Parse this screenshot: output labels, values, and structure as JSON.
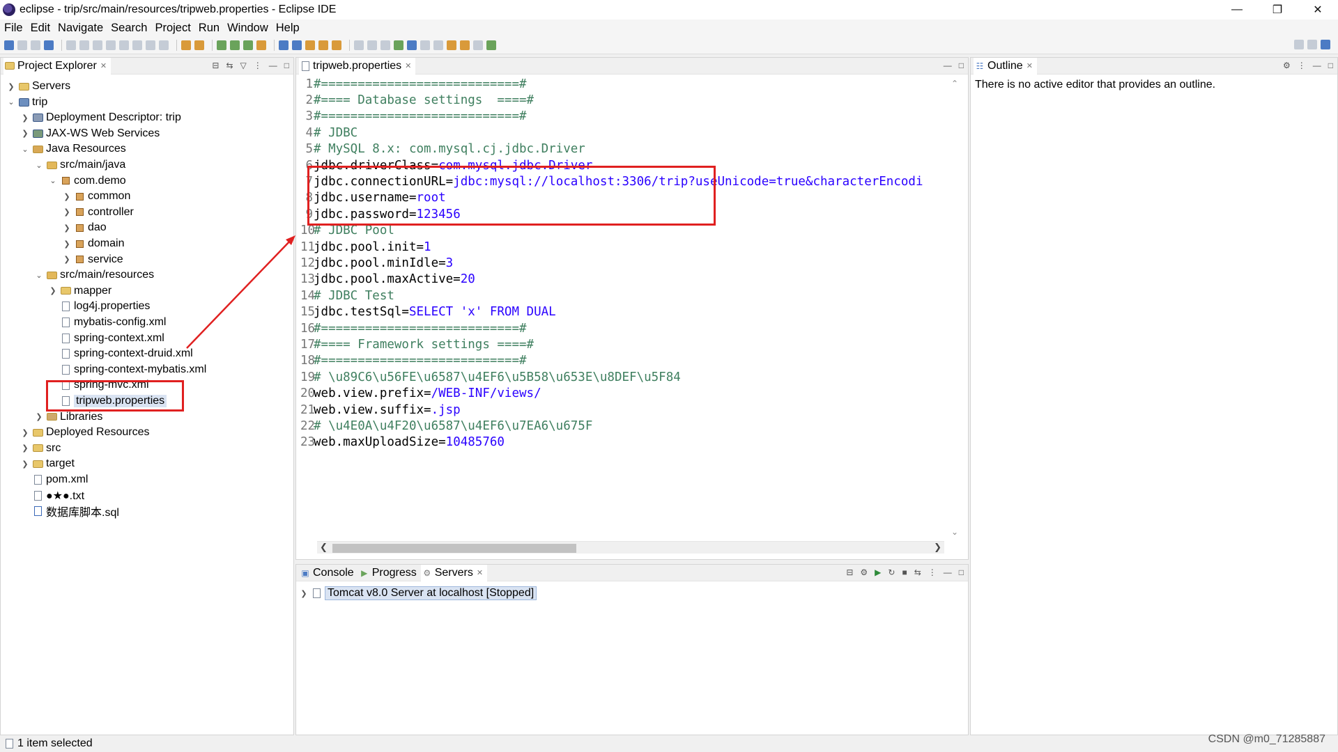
{
  "window": {
    "title": "eclipse - trip/src/main/resources/tripweb.properties - Eclipse IDE"
  },
  "menu": [
    "File",
    "Edit",
    "Navigate",
    "Search",
    "Project",
    "Run",
    "Window",
    "Help"
  ],
  "explorer": {
    "tab": "Project Explorer",
    "items": [
      {
        "label": "Servers",
        "depth": 0,
        "twisty": "collapsed",
        "icon": "folder-icon"
      },
      {
        "label": "trip",
        "depth": 0,
        "twisty": "expanded",
        "icon": "project-icon"
      },
      {
        "label": "Deployment Descriptor: trip",
        "depth": 1,
        "twisty": "collapsed",
        "icon": "descriptor-icon"
      },
      {
        "label": "JAX-WS Web Services",
        "depth": 1,
        "twisty": "collapsed",
        "icon": "webservice-icon"
      },
      {
        "label": "Java Resources",
        "depth": 1,
        "twisty": "expanded",
        "icon": "java-resources-icon"
      },
      {
        "label": "src/main/java",
        "depth": 2,
        "twisty": "expanded",
        "icon": "source-folder-icon"
      },
      {
        "label": "com.demo",
        "depth": 3,
        "twisty": "expanded",
        "icon": "package-icon"
      },
      {
        "label": "common",
        "depth": 4,
        "twisty": "collapsed",
        "icon": "package-icon"
      },
      {
        "label": "controller",
        "depth": 4,
        "twisty": "collapsed",
        "icon": "package-icon"
      },
      {
        "label": "dao",
        "depth": 4,
        "twisty": "collapsed",
        "icon": "package-icon"
      },
      {
        "label": "domain",
        "depth": 4,
        "twisty": "collapsed",
        "icon": "package-icon"
      },
      {
        "label": "service",
        "depth": 4,
        "twisty": "collapsed",
        "icon": "package-icon"
      },
      {
        "label": "src/main/resources",
        "depth": 2,
        "twisty": "expanded",
        "icon": "source-folder-icon"
      },
      {
        "label": "mapper",
        "depth": 3,
        "twisty": "collapsed",
        "icon": "folder-icon"
      },
      {
        "label": "log4j.properties",
        "depth": 3,
        "twisty": "none",
        "icon": "file-icon"
      },
      {
        "label": "mybatis-config.xml",
        "depth": 3,
        "twisty": "none",
        "icon": "xml-file-icon"
      },
      {
        "label": "spring-context.xml",
        "depth": 3,
        "twisty": "none",
        "icon": "xml-file-icon"
      },
      {
        "label": "spring-context-druid.xml",
        "depth": 3,
        "twisty": "none",
        "icon": "xml-file-icon"
      },
      {
        "label": "spring-context-mybatis.xml",
        "depth": 3,
        "twisty": "none",
        "icon": "xml-file-icon"
      },
      {
        "label": "spring-mvc.xml",
        "depth": 3,
        "twisty": "none",
        "icon": "xml-file-icon"
      },
      {
        "label": "tripweb.properties",
        "depth": 3,
        "twisty": "none",
        "icon": "file-icon",
        "selected": true
      },
      {
        "label": "Libraries",
        "depth": 2,
        "twisty": "collapsed",
        "icon": "library-icon"
      },
      {
        "label": "Deployed Resources",
        "depth": 1,
        "twisty": "collapsed",
        "icon": "folder-icon"
      },
      {
        "label": "src",
        "depth": 1,
        "twisty": "collapsed",
        "icon": "folder-icon"
      },
      {
        "label": "target",
        "depth": 1,
        "twisty": "collapsed",
        "icon": "folder-icon"
      },
      {
        "label": "pom.xml",
        "depth": 1,
        "twisty": "none",
        "icon": "xml-file-icon"
      },
      {
        "label": "●★●.txt",
        "depth": 1,
        "twisty": "none",
        "icon": "file-icon"
      },
      {
        "label": "数据库脚本.sql",
        "depth": 1,
        "twisty": "none",
        "icon": "sql-file-icon"
      }
    ]
  },
  "editor": {
    "tab": "tripweb.properties",
    "lines": [
      {
        "n": "1",
        "parts": [
          {
            "t": "#===========================#",
            "c": "c-comment"
          }
        ]
      },
      {
        "n": "2",
        "parts": [
          {
            "t": "#==== Database settings  ====#",
            "c": "c-comment"
          }
        ]
      },
      {
        "n": "3",
        "parts": [
          {
            "t": "#===========================#",
            "c": "c-comment"
          }
        ]
      },
      {
        "n": "4",
        "parts": [
          {
            "t": "# JDBC",
            "c": "c-comment"
          }
        ]
      },
      {
        "n": "5",
        "parts": [
          {
            "t": "# MySQL 8.x: com.mysql.cj.jdbc.Driver",
            "c": "c-comment"
          }
        ]
      },
      {
        "n": "6",
        "parts": [
          {
            "t": "jdbc.driverClass=",
            "c": "c-key"
          },
          {
            "t": "com.mysql.jdbc.Driver",
            "c": "c-val"
          }
        ]
      },
      {
        "n": "7",
        "parts": [
          {
            "t": "jdbc.connectionURL=",
            "c": "c-key"
          },
          {
            "t": "jdbc:mysql://localhost:3306/trip?useUnicode=true&characterEncodi",
            "c": "c-val"
          }
        ]
      },
      {
        "n": "8",
        "parts": [
          {
            "t": "jdbc.username=",
            "c": "c-key"
          },
          {
            "t": "root",
            "c": "c-val"
          }
        ]
      },
      {
        "n": "9",
        "parts": [
          {
            "t": "jdbc.password=",
            "c": "c-key"
          },
          {
            "t": "123456",
            "c": "c-val"
          }
        ]
      },
      {
        "n": "10",
        "parts": [
          {
            "t": "# JDBC Pool",
            "c": "c-comment"
          }
        ]
      },
      {
        "n": "11",
        "parts": [
          {
            "t": "jdbc.pool.init=",
            "c": "c-key"
          },
          {
            "t": "1",
            "c": "c-val"
          }
        ]
      },
      {
        "n": "12",
        "parts": [
          {
            "t": "jdbc.pool.minIdle=",
            "c": "c-key"
          },
          {
            "t": "3",
            "c": "c-val"
          }
        ]
      },
      {
        "n": "13",
        "parts": [
          {
            "t": "jdbc.pool.maxActive=",
            "c": "c-key"
          },
          {
            "t": "20",
            "c": "c-val"
          }
        ]
      },
      {
        "n": "14",
        "parts": [
          {
            "t": "# JDBC Test",
            "c": "c-comment"
          }
        ]
      },
      {
        "n": "15",
        "parts": [
          {
            "t": "jdbc.testSql=",
            "c": "c-key"
          },
          {
            "t": "SELECT 'x' FROM DUAL",
            "c": "c-val"
          }
        ]
      },
      {
        "n": "16",
        "parts": [
          {
            "t": "#===========================#",
            "c": "c-comment"
          }
        ]
      },
      {
        "n": "17",
        "parts": [
          {
            "t": "#==== Framework settings ====#",
            "c": "c-comment"
          }
        ]
      },
      {
        "n": "18",
        "parts": [
          {
            "t": "#===========================#",
            "c": "c-comment"
          }
        ]
      },
      {
        "n": "19",
        "parts": [
          {
            "t": "# \\u89C6\\u56FE\\u6587\\u4EF6\\u5B58\\u653E\\u8DEF\\u5F84",
            "c": "c-comment"
          }
        ]
      },
      {
        "n": "20",
        "parts": [
          {
            "t": "web.view.prefix=",
            "c": "c-key"
          },
          {
            "t": "/WEB-INF/views/",
            "c": "c-val"
          }
        ]
      },
      {
        "n": "21",
        "parts": [
          {
            "t": "web.view.suffix=",
            "c": "c-key"
          },
          {
            "t": ".jsp",
            "c": "c-val"
          }
        ]
      },
      {
        "n": "22",
        "parts": [
          {
            "t": "# \\u4E0A\\u4F20\\u6587\\u4EF6\\u7EA6\\u675F",
            "c": "c-comment"
          }
        ]
      },
      {
        "n": "23",
        "parts": [
          {
            "t": "web.maxUploadSize=",
            "c": "c-key"
          },
          {
            "t": "10485760",
            "c": "c-val"
          }
        ]
      }
    ]
  },
  "outline": {
    "tab": "Outline",
    "message": "There is no active editor that provides an outline."
  },
  "bottom": {
    "tabs": [
      "Console",
      "Progress",
      "Servers"
    ],
    "server": "Tomcat v8.0 Server at localhost  [Stopped]"
  },
  "status": "1 item selected",
  "watermark": "CSDN @m0_71285887",
  "colors": {
    "comment": "#3f7f5f",
    "value": "#2a00ff",
    "annotation": "#e02020",
    "selection": "#d9e3f2"
  }
}
